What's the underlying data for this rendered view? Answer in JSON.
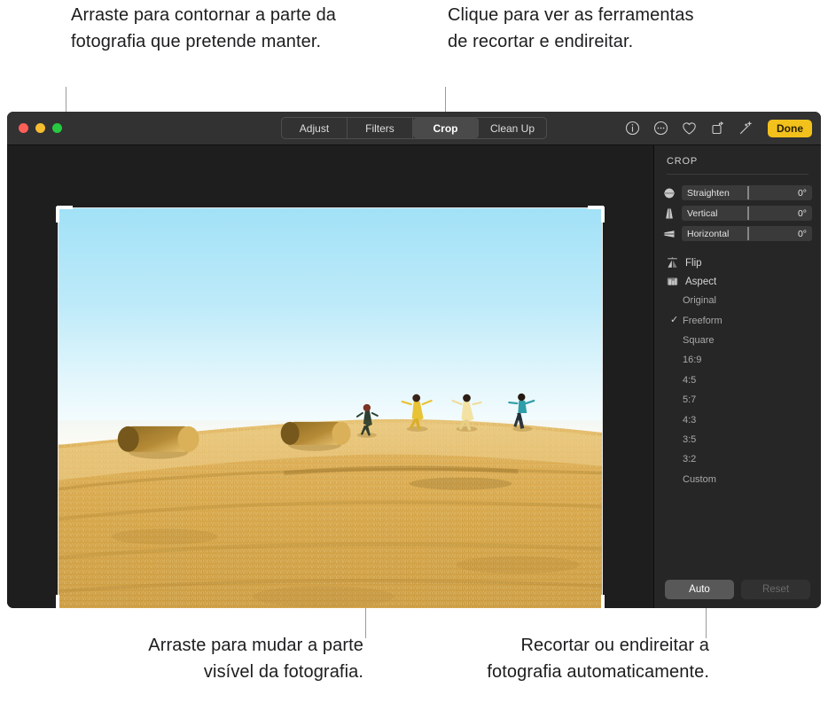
{
  "callouts": {
    "top_left": "Arraste para contornar a parte da fotografia que pretende manter.",
    "top_right": "Clique para ver as ferramentas de recortar e endireitar.",
    "bottom_left": "Arraste para mudar a parte visível da fotografia.",
    "bottom_right": "Recortar ou endireitar a fotografia automaticamente."
  },
  "window": {
    "traffic_lights": [
      "close",
      "minimize",
      "zoom"
    ],
    "tabs": [
      {
        "label": "Adjust",
        "active": false
      },
      {
        "label": "Filters",
        "active": false
      },
      {
        "label": "Crop",
        "active": true
      },
      {
        "label": "Clean Up",
        "active": false
      }
    ],
    "toolbar_icons": [
      "info-icon",
      "more-options-icon",
      "favorite-heart-icon",
      "rotate-icon",
      "magic-wand-icon"
    ],
    "done_label": "Done"
  },
  "panel": {
    "title": "CROP",
    "sliders": [
      {
        "icon": "straighten-icon",
        "label": "Straighten",
        "value": "0°"
      },
      {
        "icon": "vertical-perspective-icon",
        "label": "Vertical",
        "value": "0°"
      },
      {
        "icon": "horizontal-perspective-icon",
        "label": "Horizontal",
        "value": "0°"
      }
    ],
    "flip": {
      "icon": "flip-icon",
      "label": "Flip"
    },
    "aspect": {
      "icon": "aspect-icon",
      "label": "Aspect"
    },
    "aspect_options": [
      {
        "label": "Original",
        "selected": false
      },
      {
        "label": "Freeform",
        "selected": true
      },
      {
        "label": "Square",
        "selected": false
      },
      {
        "label": "16:9",
        "selected": false
      },
      {
        "label": "4:5",
        "selected": false
      },
      {
        "label": "5:7",
        "selected": false
      },
      {
        "label": "4:3",
        "selected": false
      },
      {
        "label": "3:5",
        "selected": false
      },
      {
        "label": "3:2",
        "selected": false
      },
      {
        "label": "Custom",
        "selected": false
      }
    ],
    "check_glyph": "✓",
    "auto_label": "Auto",
    "reset_label": "Reset"
  },
  "photo": {
    "description": "Campo de restolho dourado ao pôr do sol com dois fardos de feno redondos e quatro pessoas a correr na crista da colina sob um céu azul claro.",
    "sky_top_color": "#a5e2f7",
    "sky_horizon_color": "#fbfdff",
    "field_color": "#d9a948"
  },
  "colors": {
    "accent": "#f2c11c",
    "window_chrome": "#323232",
    "canvas_background": "#1e1e1e",
    "panel_background": "#262626"
  }
}
